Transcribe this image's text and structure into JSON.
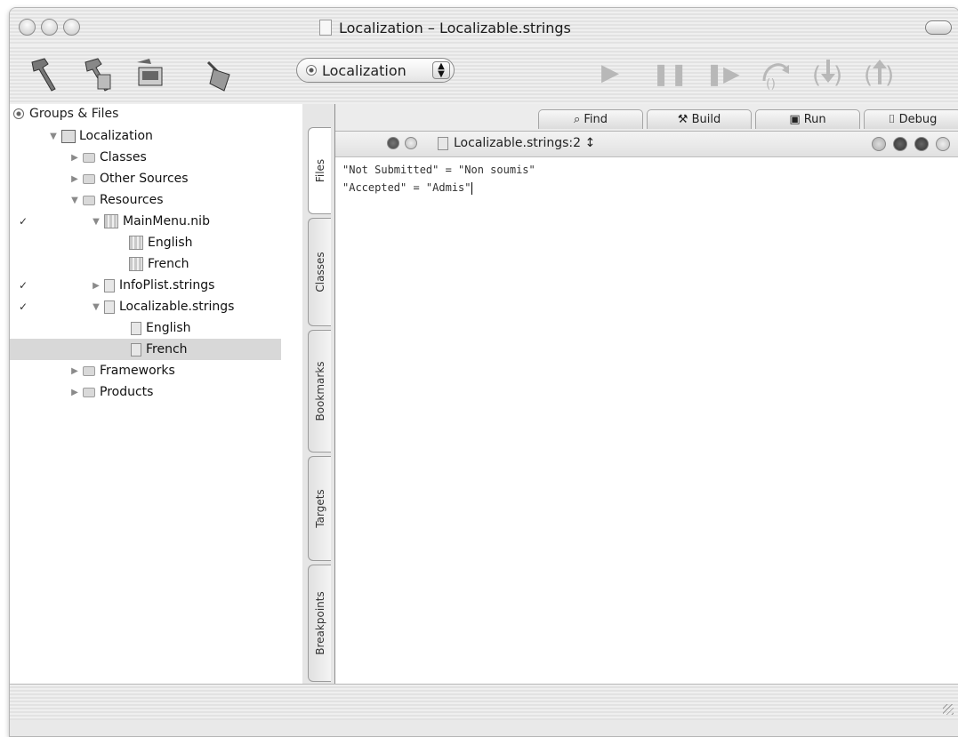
{
  "window": {
    "title": "Localization – Localizable.strings"
  },
  "toolbar": {
    "target_popup": "Localization",
    "icons": [
      "build-hammer-icon",
      "build-and-run-icon",
      "build-and-debug-icon",
      "clean-broom-icon",
      "run-icon",
      "pause-icon",
      "continue-icon",
      "step-over-icon",
      "step-into-icon",
      "step-out-icon"
    ]
  },
  "sidebar": {
    "header": "Groups & Files",
    "items": [
      {
        "label": "Localization",
        "checked": false
      },
      {
        "label": "Classes",
        "checked": false
      },
      {
        "label": "Other Sources",
        "checked": false
      },
      {
        "label": "Resources",
        "checked": false
      },
      {
        "label": "MainMenu.nib",
        "checked": true
      },
      {
        "label": "English",
        "checked": false
      },
      {
        "label": "French",
        "checked": false
      },
      {
        "label": "InfoPlist.strings",
        "checked": true
      },
      {
        "label": "Localizable.strings",
        "checked": true
      },
      {
        "label": "English",
        "checked": false
      },
      {
        "label": "French",
        "checked": false,
        "selected": true
      },
      {
        "label": "Frameworks",
        "checked": false
      },
      {
        "label": "Products",
        "checked": false
      }
    ],
    "check_mark": "✓"
  },
  "vtabs": [
    "Files",
    "Classes",
    "Bookmarks",
    "Targets",
    "Breakpoints"
  ],
  "editor": {
    "tabs": [
      "Find",
      "Build",
      "Run",
      "Debug"
    ],
    "file_popup": "Localizable.strings:2 ↕",
    "lines": [
      "\"Not Submitted\" = \"Non soumis\"",
      "\"Accepted\" = \"Admis\""
    ]
  }
}
